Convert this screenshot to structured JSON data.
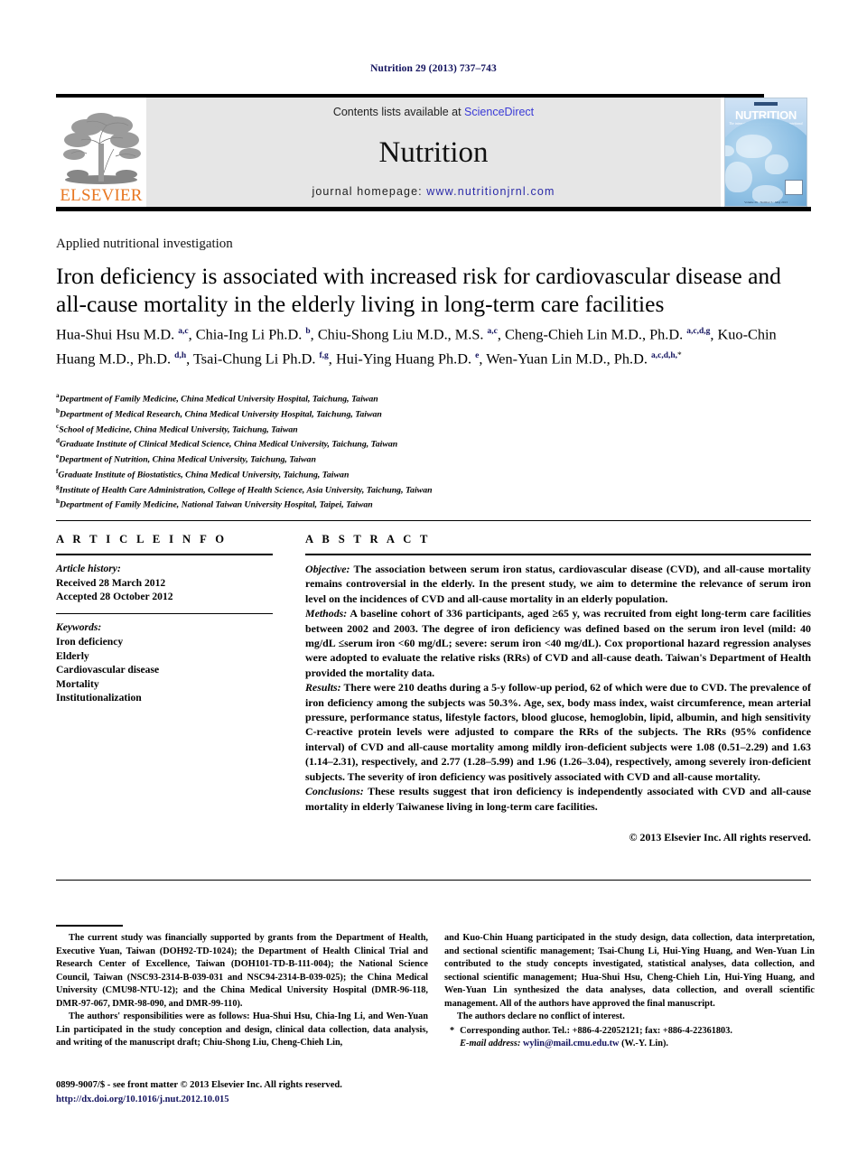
{
  "running_head": "Nutrition 29 (2013) 737–743",
  "masthead": {
    "publisher_name": "ELSEVIER",
    "contents_prefix": "Contents lists available at ",
    "contents_link": "ScienceDirect",
    "journal_name": "Nutrition",
    "homepage_label": "journal homepage: ",
    "homepage_url": "www.nutritionjrnl.com",
    "cover": {
      "title": "NUTRITION",
      "subtitle": "The international journal of applied and basic nutritional sciences",
      "footer": "Volume 29 · Number 5 · May 2013"
    }
  },
  "section_label": "Applied nutritional investigation",
  "title": "Iron deficiency is associated with increased risk for cardiovascular disease and all-cause mortality in the elderly living in long-term care facilities",
  "authors": [
    {
      "name": "Hua-Shui Hsu M.D.",
      "marks": "a,c",
      "sep": ", "
    },
    {
      "name": "Chia-Ing Li Ph.D.",
      "marks": "b",
      "sep": ", "
    },
    {
      "name": "Chiu-Shong Liu M.D., M.S.",
      "marks": "a,c",
      "sep": ", "
    },
    {
      "name": "Cheng-Chieh Lin M.D., Ph.D.",
      "marks": "a,c,d,g",
      "sep": ", "
    },
    {
      "name": "Kuo-Chin Huang M.D., Ph.D.",
      "marks": "d,h",
      "sep": ", "
    },
    {
      "name": "Tsai-Chung Li Ph.D.",
      "marks": "f,g",
      "sep": ", "
    },
    {
      "name": "Hui-Ying Huang Ph.D.",
      "marks": "e",
      "sep": ", "
    },
    {
      "name": "Wen-Yuan Lin M.D., Ph.D.",
      "marks": "a,c,d,h,",
      "star": "*",
      "sep": ""
    }
  ],
  "affiliations": [
    {
      "mark": "a",
      "text": "Department of Family Medicine, China Medical University Hospital, Taichung, Taiwan"
    },
    {
      "mark": "b",
      "text": "Department of Medical Research, China Medical University Hospital, Taichung, Taiwan"
    },
    {
      "mark": "c",
      "text": "School of Medicine, China Medical University, Taichung, Taiwan"
    },
    {
      "mark": "d",
      "text": "Graduate Institute of Clinical Medical Science, China Medical University, Taichung, Taiwan"
    },
    {
      "mark": "e",
      "text": "Department of Nutrition, China Medical University, Taichung, Taiwan"
    },
    {
      "mark": "f",
      "text": "Graduate Institute of Biostatistics, China Medical University, Taichung, Taiwan"
    },
    {
      "mark": "g",
      "text": "Institute of Health Care Administration, College of Health Science, Asia University, Taichung, Taiwan"
    },
    {
      "mark": "h",
      "text": "Department of Family Medicine, National Taiwan University Hospital, Taipei, Taiwan"
    }
  ],
  "article_info": {
    "heading": "A R T I C L E  I N F O",
    "history_label": "Article history:",
    "received": "Received 28 March 2012",
    "accepted": "Accepted 28 October 2012",
    "keywords_label": "Keywords:",
    "keywords": [
      "Iron deficiency",
      "Elderly",
      "Cardiovascular disease",
      "Mortality",
      "Institutionalization"
    ]
  },
  "abstract": {
    "heading": "A B S T R A C T",
    "objective_label": "Objective:",
    "objective_text": " The association between serum iron status, cardiovascular disease (CVD), and all-cause mortality remains controversial in the elderly. In the present study, we aim to determine the relevance of serum iron level on the incidences of CVD and all-cause mortality in an elderly population.",
    "methods_label": "Methods:",
    "methods_text": " A baseline cohort of 336 participants, aged ≥65 y, was recruited from eight long-term care facilities between 2002 and 2003. The degree of iron deficiency was defined based on the serum iron level (mild: 40 mg/dL ≤serum iron <60 mg/dL; severe: serum iron <40 mg/dL). Cox proportional hazard regression analyses were adopted to evaluate the relative risks (RRs) of CVD and all-cause death. Taiwan's Department of Health provided the mortality data.",
    "results_label": "Results:",
    "results_text": " There were 210 deaths during a 5-y follow-up period, 62 of which were due to CVD. The prevalence of iron deficiency among the subjects was 50.3%. Age, sex, body mass index, waist circumference, mean arterial pressure, performance status, lifestyle factors, blood glucose, hemoglobin, lipid, albumin, and high sensitivity C-reactive protein levels were adjusted to compare the RRs of the subjects. The RRs (95% confidence interval) of CVD and all-cause mortality among mildly iron-deficient subjects were 1.08 (0.51–2.29) and 1.63 (1.14–2.31), respectively, and 2.77 (1.28–5.99) and 1.96 (1.26–3.04), respectively, among severely iron-deficient subjects. The severity of iron deficiency was positively associated with CVD and all-cause mortality.",
    "conclusions_label": "Conclusions:",
    "conclusions_text": " These results suggest that iron deficiency is independently associated with CVD and all-cause mortality in elderly Taiwanese living in long-term care facilities.",
    "copyright": "© 2013 Elsevier Inc. All rights reserved."
  },
  "footnotes": {
    "funding": "The current study was financially supported by grants from the Department of Health, Executive Yuan, Taiwan (DOH92-TD-1024); the Department of Health Clinical Trial and Research Center of Excellence, Taiwan (DOH101-TD-B-111-004); the National Science Council, Taiwan (NSC93-2314-B-039-031 and NSC94-2314-B-039-025); the China Medical University (CMU98-NTU-12); and the China Medical University Hospital (DMR-96-118, DMR-97-067, DMR-98-090, and DMR-99-110).",
    "responsibilities_part1": "The authors' responsibilities were as follows: Hua-Shui Hsu, Chia-Ing Li, and Wen-Yuan Lin participated in the study conception and design, clinical data collection, data analysis, and writing of the manuscript draft; Chiu-Shong Liu, Cheng-Chieh Lin,",
    "responsibilities_part2": "and Kuo-Chin Huang participated in the study design, data collection, data interpretation, and sectional scientific management; Tsai-Chung Li, Hui-Ying Huang, and Wen-Yuan Lin contributed to the study concepts investigated, statistical analyses, data collection, and sectional scientific management; Hua-Shui Hsu, Cheng-Chieh Lin, Hui-Ying Huang, and Wen-Yuan Lin synthesized the data analyses, data collection, and overall scientific management. All of the authors have approved the final manuscript.",
    "conflict": "The authors declare no conflict of interest.",
    "corresponding_star": "*",
    "corresponding_text": "Corresponding author. Tel.: +886-4-22052121; fax: +886-4-22361803.",
    "email_label": "E-mail address:",
    "email": "wylin@mail.cmu.edu.tw",
    "email_owner": "(W.-Y. Lin)."
  },
  "bottom": {
    "issn": "0899-9007/$ - see front matter © 2013 Elsevier Inc. All rights reserved.",
    "doi": "http://dx.doi.org/10.1016/j.nut.2012.10.015"
  },
  "colors": {
    "link_blue": "#2a2aa8",
    "dark_navy": "#13135e",
    "elsevier_orange": "#e87722",
    "panel_grey": "#e6e6e6"
  }
}
